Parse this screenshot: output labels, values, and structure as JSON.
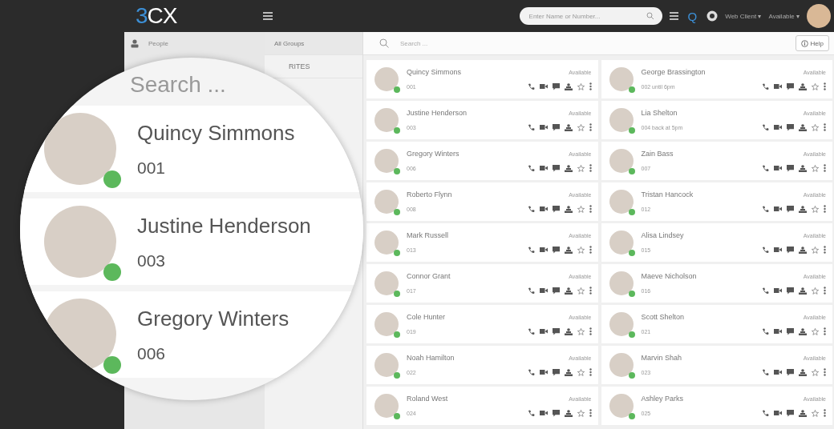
{
  "topbar": {
    "logo_digit": "3",
    "logo_text": "CX",
    "search_placeholder": "Enter Name or Number...",
    "q_label": "Q",
    "client_menu": "Web Client ▾",
    "status_menu": "Available ▾"
  },
  "sidebar": {
    "items": [
      {
        "label": "People"
      }
    ]
  },
  "groups": {
    "items": [
      {
        "label": "All Groups"
      },
      {
        "label": "RITES"
      }
    ]
  },
  "content": {
    "search_placeholder": "Search ...",
    "help": "Help"
  },
  "contacts": [
    {
      "name": "Quincy Simmons",
      "ext": "001",
      "status": "Available",
      "online": true
    },
    {
      "name": "George Brassington",
      "ext": "002 until 6pm",
      "status": "Available",
      "online": true
    },
    {
      "name": "Justine Henderson",
      "ext": "003",
      "status": "Available",
      "online": true
    },
    {
      "name": "Lia Shelton",
      "ext": "004 back at 5pm",
      "status": "Available",
      "online": true
    },
    {
      "name": "Gregory Winters",
      "ext": "006",
      "status": "Available",
      "online": true
    },
    {
      "name": "Zain Bass",
      "ext": "007",
      "status": "Available",
      "online": true
    },
    {
      "name": "Roberto Flynn",
      "ext": "008",
      "status": "Available",
      "online": true
    },
    {
      "name": "Tristan Hancock",
      "ext": "012",
      "status": "Available",
      "online": true
    },
    {
      "name": "Mark Russell",
      "ext": "013",
      "status": "Available",
      "online": true
    },
    {
      "name": "Alisa Lindsey",
      "ext": "015",
      "status": "Available",
      "online": true
    },
    {
      "name": "Connor Grant",
      "ext": "017",
      "status": "Available",
      "online": true
    },
    {
      "name": "Maeve Nicholson",
      "ext": "016",
      "status": "Available",
      "online": true
    },
    {
      "name": "Cole Hunter",
      "ext": "019",
      "status": "Available",
      "online": true
    },
    {
      "name": "Scott Shelton",
      "ext": "021",
      "status": "Available",
      "online": true
    },
    {
      "name": "Noah Hamilton",
      "ext": "022",
      "status": "Available",
      "online": true
    },
    {
      "name": "Marvin Shah",
      "ext": "023",
      "status": "Available",
      "online": true
    },
    {
      "name": "Roland West",
      "ext": "024",
      "status": "Available",
      "online": true
    },
    {
      "name": "Ashley Parks",
      "ext": "025",
      "status": "Available",
      "online": true
    }
  ],
  "magnifier": {
    "search_placeholder": "Search ...",
    "contacts": [
      {
        "name": "Quincy Simmons",
        "ext": "001",
        "online": true
      },
      {
        "name": "Justine Henderson",
        "ext": "003",
        "online": true
      },
      {
        "name": "Gregory Winters",
        "ext": "006",
        "online": true
      }
    ]
  }
}
